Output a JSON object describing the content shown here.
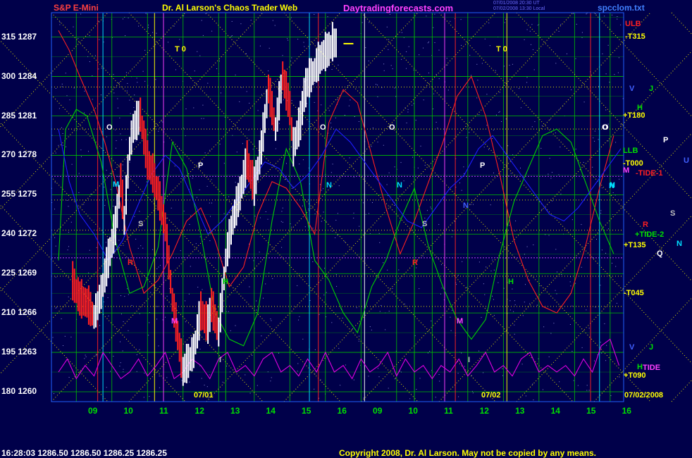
{
  "header": {
    "left_title": "S&P E-Mini",
    "center_title": "Dr. Al Larson's Chaos Trader Web",
    "site": "Daytradingforecasts.com",
    "file_name": "spcclom.txt",
    "small_line1": "07/01/2008 20:30 UT",
    "small_line2": "07/02/2008 13:30 Local",
    "colors": {
      "left_title": "#ff4040",
      "center_title": "#ffff00",
      "site": "#ff40ff",
      "file_name": "#4080ff"
    }
  },
  "footer": {
    "status": "16:28:03  1286.50  1286.50  1286.25  1286.25",
    "copyright": "Copyright 2008, Dr. Al Larson. May not be copied by any means.",
    "colors": {
      "status": "#ffffff",
      "copyright": "#ffff00"
    }
  },
  "plot_labels": [
    {
      "text": "07/01",
      "color": "#ffff00"
    },
    {
      "text": "07/02",
      "color": "#ffff00"
    },
    {
      "text": "07/02/2008",
      "color": "#ffff00"
    },
    {
      "text": "T 0",
      "color": "#ffff00"
    },
    {
      "text": "T 0",
      "color": "#ffff00"
    }
  ],
  "right_labels": [
    {
      "text": "ULB",
      "color": "#ff2020"
    },
    {
      "text": "-T315",
      "color": "#ffff00"
    },
    {
      "text": "V",
      "color": "#4060ff"
    },
    {
      "text": "J",
      "color": "#00e000"
    },
    {
      "text": "H",
      "color": "#00e000"
    },
    {
      "text": "+T180",
      "color": "#ffff00"
    },
    {
      "text": "O",
      "color": "#ffffff"
    },
    {
      "text": "P",
      "color": "#ffffff"
    },
    {
      "text": "LLB",
      "color": "#00e000"
    },
    {
      "text": "-T000",
      "color": "#ffff00"
    },
    {
      "text": "U",
      "color": "#4060ff"
    },
    {
      "text": "M",
      "color": "#ff40ff"
    },
    {
      "text": "-TIDE-1",
      "color": "#ff2020"
    },
    {
      "text": "N",
      "color": "#00e0ff"
    },
    {
      "text": "S",
      "color": "#c0c0c0"
    },
    {
      "text": "R",
      "color": "#ff2020"
    },
    {
      "text": "+TIDE-2",
      "color": "#00e000"
    },
    {
      "text": "+T135",
      "color": "#ffff00"
    },
    {
      "text": "N",
      "color": "#00e0ff"
    },
    {
      "text": "Q",
      "color": "#ffffff"
    },
    {
      "text": "-T045",
      "color": "#ffff00"
    },
    {
      "text": "V",
      "color": "#4060ff"
    },
    {
      "text": "J",
      "color": "#00e000"
    },
    {
      "text": "H",
      "color": "#00e000"
    },
    {
      "text": "TIDE",
      "color": "#ff40ff"
    },
    {
      "text": "+T090",
      "color": "#ffff00"
    }
  ],
  "planet_markers": [
    {
      "text": "O",
      "color": "#ffffff"
    },
    {
      "text": "M",
      "color": "#00e0ff"
    },
    {
      "text": "S",
      "color": "#c0c0c0"
    },
    {
      "text": "R",
      "color": "#ff2020"
    },
    {
      "text": "M",
      "color": "#ff40ff"
    },
    {
      "text": "P",
      "color": "#ffffff"
    },
    {
      "text": "H",
      "color": "#00e000"
    },
    {
      "text": "I",
      "color": "#c0c0c0"
    },
    {
      "text": "O",
      "color": "#ffffff"
    },
    {
      "text": "N",
      "color": "#00e0ff"
    },
    {
      "text": "O",
      "color": "#ffffff"
    },
    {
      "text": "N",
      "color": "#00e0ff"
    },
    {
      "text": "S",
      "color": "#c0c0c0"
    },
    {
      "text": "R",
      "color": "#ff2020"
    },
    {
      "text": "N",
      "color": "#4060ff"
    },
    {
      "text": "M",
      "color": "#ff40ff"
    },
    {
      "text": "I",
      "color": "#c0c0c0"
    },
    {
      "text": "P",
      "color": "#ffffff"
    },
    {
      "text": "H",
      "color": "#00e000"
    },
    {
      "text": "O",
      "color": "#ffffff"
    },
    {
      "text": "N",
      "color": "#00e0ff"
    }
  ],
  "chart_data": {
    "type": "line",
    "title": "S&P E-Mini",
    "y_tick_labels": [
      {
        "angle": "315",
        "price": "1287"
      },
      {
        "angle": "300",
        "price": "1284"
      },
      {
        "angle": "285",
        "price": "1281"
      },
      {
        "angle": "270",
        "price": "1278"
      },
      {
        "angle": "255",
        "price": "1275"
      },
      {
        "angle": "240",
        "price": "1272"
      },
      {
        "angle": "225",
        "price": "1269"
      },
      {
        "angle": "210",
        "price": "1266"
      },
      {
        "angle": "195",
        "price": "1263"
      },
      {
        "angle": "180",
        "price": "1260"
      }
    ],
    "x_tick_labels": [
      "09",
      "10",
      "11",
      "12",
      "13",
      "14",
      "15",
      "16",
      "09",
      "10",
      "11",
      "12",
      "13",
      "14",
      "15",
      "16"
    ],
    "ylim": [
      1260,
      1288
    ],
    "x_unit": "session hour (0 = 07/01 08:30, 8 = 07/02 08:30)",
    "xlim": [
      0,
      15.8
    ],
    "grid": true,
    "colors": {
      "price_up": "#ffffff",
      "price_down": "#ff2020",
      "flux_red": "#ff2020",
      "flux_green": "#00d000",
      "flux_blue": "#1e1eff",
      "tide_magenta": "#e000e0",
      "grid_yellow": "#e0e000",
      "grid_green": "#00c000"
    },
    "series": [
      {
        "name": "price",
        "x": [
          0.4,
          0.6,
          0.8,
          1.0,
          1.1,
          1.2,
          1.4,
          1.6,
          1.75,
          1.85,
          2.0,
          2.1,
          2.3,
          2.5,
          2.65,
          2.8,
          3.0,
          3.2,
          3.5,
          3.8,
          4.0,
          4.2,
          4.3,
          4.5,
          4.7,
          4.9,
          5.1,
          5.3,
          5.5,
          5.7,
          5.9,
          6.1,
          6.3,
          6.5,
          6.6,
          6.8,
          6.9,
          7.0,
          7.2,
          7.4,
          7.6,
          7.7,
          7.85
        ],
        "values": [
          1268.3,
          1267.0,
          1266.7,
          1265.7,
          1266.5,
          1267.5,
          1270.0,
          1272.5,
          1276.0,
          1273.0,
          1278.5,
          1280.0,
          1281.0,
          1277.5,
          1276.5,
          1275.0,
          1272.5,
          1267.0,
          1261.5,
          1263.0,
          1266.0,
          1265.0,
          1266.5,
          1264.5,
          1270.0,
          1273.0,
          1275.0,
          1277.5,
          1275.5,
          1278.5,
          1283.0,
          1280.0,
          1284.0,
          1281.5,
          1278.5,
          1280.5,
          1282.5,
          1283.5,
          1284.5,
          1285.5,
          1286.0,
          1286.5,
          1286.5
        ]
      },
      {
        "name": "",
        "x": [
          0,
          0.3,
          0.6,
          1.0,
          1.3,
          1.6,
          2.0,
          2.4,
          2.8,
          3.2,
          3.6,
          4.0,
          4.4,
          4.8,
          5.2,
          5.6,
          6.0,
          6.4,
          6.8,
          7.2,
          7.6,
          8.0,
          8.4,
          8.8,
          9.2,
          9.6,
          10.0,
          10.4,
          10.8,
          11.2,
          11.6,
          12.0,
          12.4,
          12.8,
          13.2,
          13.6,
          14.0,
          14.4,
          14.8,
          15.2,
          15.6
        ],
        "values": [
          1287.5,
          1286.0,
          1284.0,
          1281.5,
          1279.0,
          1276.0,
          1271.0,
          1267.5,
          1268.5,
          1270.5,
          1273.0,
          1274.0,
          1271.5,
          1268.0,
          1269.5,
          1273.5,
          1276.0,
          1275.5,
          1274.0,
          1272.0,
          1280.5,
          1283.0,
          1282.0,
          1278.0,
          1274.0,
          1270.5,
          1273.0,
          1276.0,
          1279.0,
          1282.5,
          1284.0,
          1281.0,
          1276.5,
          1271.5,
          1268.5,
          1266.5,
          1266.0,
          1267.5,
          1271.0,
          1275.5,
          1279.5
        ]
      },
      {
        "name": "",
        "x": [
          0,
          0.2,
          0.5,
          0.8,
          1.2,
          1.6,
          2.0,
          2.4,
          2.8,
          3.2,
          3.6,
          4.0,
          4.4,
          4.8,
          5.2,
          5.6,
          6.0,
          6.4,
          6.8,
          7.2,
          7.6,
          8.0,
          8.4,
          8.8,
          9.2,
          9.6,
          10.0,
          10.4,
          10.8,
          11.2,
          11.6,
          12.0,
          12.4,
          12.8,
          13.2,
          13.6,
          14.0,
          14.4,
          14.8,
          15.2,
          15.6
        ],
        "values": [
          1270.0,
          1280.0,
          1281.5,
          1281.0,
          1277.5,
          1271.5,
          1267.5,
          1268.0,
          1271.0,
          1279.0,
          1277.0,
          1272.0,
          1266.0,
          1264.0,
          1263.5,
          1266.0,
          1273.0,
          1278.5,
          1276.0,
          1270.0,
          1268.5,
          1266.0,
          1264.5,
          1268.0,
          1270.0,
          1273.0,
          1275.5,
          1271.0,
          1268.0,
          1265.5,
          1264.0,
          1265.5,
          1270.5,
          1274.5,
          1277.0,
          1279.5,
          1280.0,
          1279.0,
          1276.0,
          1273.0,
          1270.5
        ]
      },
      {
        "name": "",
        "x": [
          0,
          0.3,
          0.6,
          1.0,
          1.4,
          1.8,
          2.2,
          2.6,
          3.0,
          3.4,
          3.8,
          4.2,
          4.6,
          5.0,
          5.4,
          5.8,
          6.2,
          6.6,
          7.0,
          7.4,
          7.8,
          8.2,
          8.6,
          9.0,
          9.4,
          9.8,
          10.2,
          10.6,
          11.0,
          11.4,
          11.8,
          12.2,
          12.6,
          13.0,
          13.4,
          13.8,
          14.2,
          14.6,
          15.0,
          15.4,
          15.8
        ],
        "values": [
          1280.0,
          1276.0,
          1273.5,
          1272.0,
          1270.0,
          1271.5,
          1274.0,
          1276.5,
          1278.0,
          1277.0,
          1274.5,
          1272.0,
          1273.0,
          1274.5,
          1276.0,
          1277.5,
          1277.0,
          1275.5,
          1276.5,
          1278.0,
          1280.0,
          1279.0,
          1277.5,
          1276.0,
          1274.5,
          1273.0,
          1272.5,
          1274.0,
          1275.5,
          1276.5,
          1278.5,
          1279.5,
          1278.0,
          1276.5,
          1275.0,
          1273.5,
          1273.0,
          1274.0,
          1275.5,
          1277.0,
          1278.5
        ]
      },
      {
        "name": "",
        "x": [
          0,
          0.25,
          0.5,
          0.75,
          1.0,
          1.25,
          1.5,
          1.75,
          2.0,
          2.25,
          2.5,
          2.75,
          3.0,
          3.25,
          3.5,
          3.75,
          4.0,
          4.25,
          4.5,
          4.75,
          5.0,
          5.25,
          5.5,
          5.75,
          6.0,
          6.25,
          6.5,
          6.75,
          7.0,
          7.25,
          7.5,
          7.75,
          8.0,
          8.25,
          8.5,
          8.75,
          9.0,
          9.25,
          9.5,
          9.75,
          10.0,
          10.25,
          10.5,
          10.75,
          11.0,
          11.25,
          11.5,
          11.75,
          12.0,
          12.25,
          12.5,
          12.75,
          13.0,
          13.25,
          13.5,
          13.75,
          14.0,
          14.25,
          14.5,
          14.75,
          15.0,
          15.25,
          15.5,
          15.75
        ],
        "values": [
          1261.5,
          1262.5,
          1261.0,
          1262.0,
          1261.2,
          1263.0,
          1262.0,
          1261.0,
          1261.5,
          1262.5,
          1261.2,
          1262.0,
          1263.0,
          1261.0,
          1261.5,
          1262.5,
          1262.0,
          1261.0,
          1262.5,
          1263.0,
          1261.5,
          1262.0,
          1261.2,
          1262.5,
          1263.0,
          1261.5,
          1262.0,
          1261.2,
          1262.5,
          1261.5,
          1263.0,
          1261.5,
          1262.0,
          1261.0,
          1262.5,
          1261.5,
          1262.0,
          1263.0,
          1261.2,
          1262.5,
          1261.5,
          1262.0,
          1261.0,
          1262.0,
          1261.5,
          1262.5,
          1261.2,
          1262.0,
          1263.0,
          1261.5,
          1262.0,
          1261.2,
          1262.5,
          1263.0,
          1261.5,
          1262.0,
          1261.5,
          1262.0,
          1261.2,
          1262.5,
          1261.5,
          1263.5,
          1264.0,
          1262.0
        ]
      }
    ],
    "vertical_markers": [
      {
        "x": 1.1,
        "color": "#ff2020"
      },
      {
        "x": 1.25,
        "color": "#00e0ff"
      },
      {
        "x": 2.7,
        "color": "#ffff00"
      },
      {
        "x": 2.95,
        "color": "#ff40ff"
      },
      {
        "x": 4.7,
        "color": "#00c000"
      },
      {
        "x": 7.05,
        "color": "#00e0ff"
      },
      {
        "x": 7.3,
        "color": "#ff2020"
      },
      {
        "x": 8.6,
        "color": "#ffffff"
      },
      {
        "x": 10.0,
        "color": "#00c000"
      },
      {
        "x": 10.85,
        "color": "#ff40ff"
      },
      {
        "x": 11.15,
        "color": "#ff2020"
      },
      {
        "x": 12.6,
        "color": "#ffff00"
      },
      {
        "x": 14.95,
        "color": "#ff2020"
      },
      {
        "x": 15.2,
        "color": "#00e0ff"
      }
    ]
  }
}
